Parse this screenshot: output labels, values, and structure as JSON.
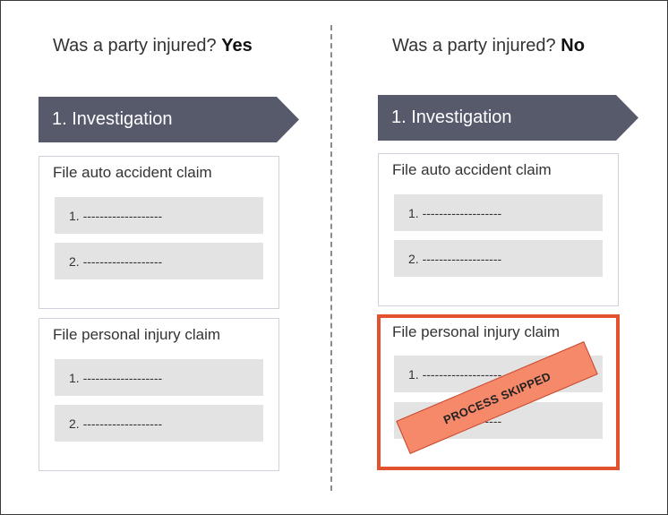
{
  "left_column": {
    "question": "Was a party injured?",
    "answer": "Yes",
    "stage_label": "1. Investigation",
    "cards": [
      {
        "title": "File auto accident claim",
        "steps": [
          "1. -------------------",
          "2. -------------------"
        ]
      },
      {
        "title": "File personal injury claim",
        "steps": [
          "1. -------------------",
          "2. -------------------"
        ]
      }
    ]
  },
  "right_column": {
    "question": "Was a party injured?",
    "answer": "No",
    "stage_label": "1. Investigation",
    "cards": [
      {
        "title": "File auto accident claim",
        "steps": [
          "1. -------------------",
          "2. -------------------"
        ]
      },
      {
        "title": "File personal injury claim",
        "steps": [
          "1. -------------------",
          "2. -------------------"
        ]
      }
    ],
    "stamp_text": "PROCESS SKIPPED"
  },
  "colors": {
    "stage_chevron": "#575a6b",
    "skipped_border": "#e2522f",
    "stamp_fill": "#f7896b",
    "step_fill": "#e3e3e4"
  }
}
